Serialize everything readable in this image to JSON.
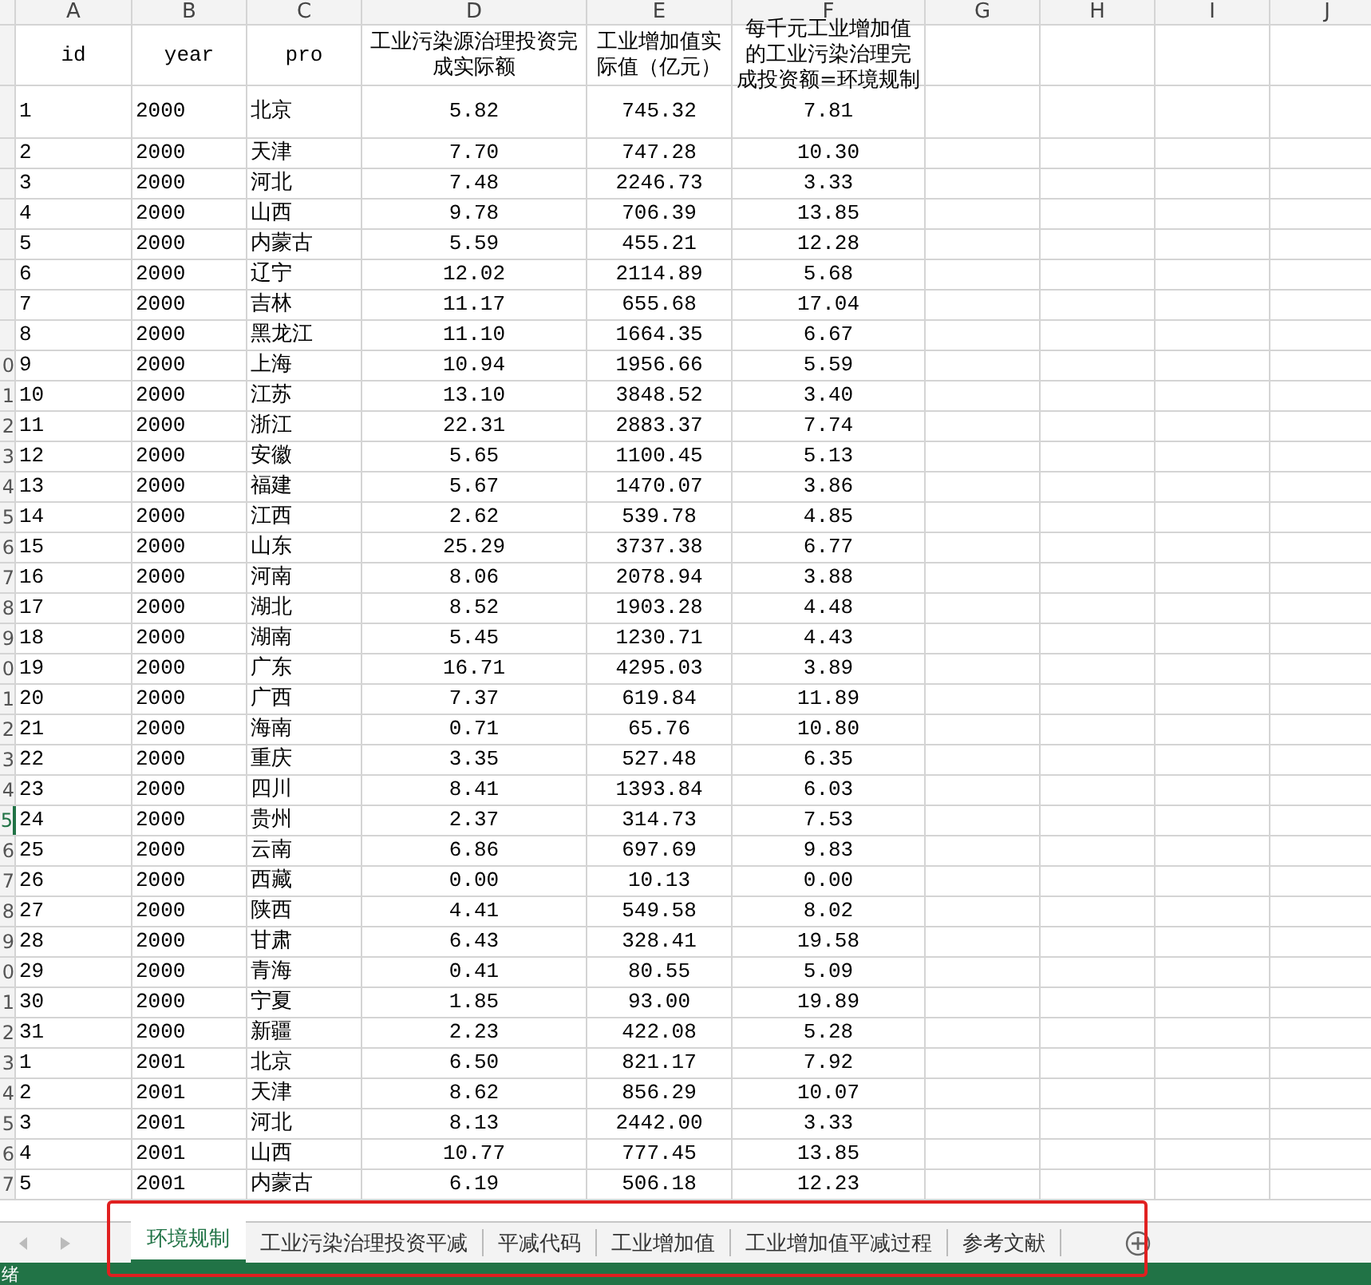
{
  "column_letters": [
    "A",
    "B",
    "C",
    "D",
    "E",
    "F",
    "G",
    "H",
    "I",
    "J"
  ],
  "header_row": [
    "id",
    "year",
    "pro",
    "工业污染源治理投资完成实际额",
    "工业增加值实际值（亿元）",
    "每千元工业增加值的工业污染治理完成投资额=环境规制"
  ],
  "rows": [
    {
      "row_number": "",
      "selected": false,
      "cells": [
        "1",
        "2000",
        "北京",
        "5.82",
        "745.32",
        "7.81"
      ]
    },
    {
      "row_number": "",
      "selected": false,
      "cells": [
        "2",
        "2000",
        "天津",
        "7.70",
        "747.28",
        "10.30"
      ]
    },
    {
      "row_number": "",
      "selected": false,
      "cells": [
        "3",
        "2000",
        "河北",
        "7.48",
        "2246.73",
        "3.33"
      ]
    },
    {
      "row_number": "",
      "selected": false,
      "cells": [
        "4",
        "2000",
        "山西",
        "9.78",
        "706.39",
        "13.85"
      ]
    },
    {
      "row_number": "",
      "selected": false,
      "cells": [
        "5",
        "2000",
        "内蒙古",
        "5.59",
        "455.21",
        "12.28"
      ]
    },
    {
      "row_number": "",
      "selected": false,
      "cells": [
        "6",
        "2000",
        "辽宁",
        "12.02",
        "2114.89",
        "5.68"
      ]
    },
    {
      "row_number": "",
      "selected": false,
      "cells": [
        "7",
        "2000",
        "吉林",
        "11.17",
        "655.68",
        "17.04"
      ]
    },
    {
      "row_number": "",
      "selected": false,
      "cells": [
        "8",
        "2000",
        "黑龙江",
        "11.10",
        "1664.35",
        "6.67"
      ]
    },
    {
      "row_number": "0",
      "selected": false,
      "cells": [
        "9",
        "2000",
        "上海",
        "10.94",
        "1956.66",
        "5.59"
      ]
    },
    {
      "row_number": "1",
      "selected": false,
      "cells": [
        "10",
        "2000",
        "江苏",
        "13.10",
        "3848.52",
        "3.40"
      ]
    },
    {
      "row_number": "2",
      "selected": false,
      "cells": [
        "11",
        "2000",
        "浙江",
        "22.31",
        "2883.37",
        "7.74"
      ]
    },
    {
      "row_number": "3",
      "selected": false,
      "cells": [
        "12",
        "2000",
        "安徽",
        "5.65",
        "1100.45",
        "5.13"
      ]
    },
    {
      "row_number": "4",
      "selected": false,
      "cells": [
        "13",
        "2000",
        "福建",
        "5.67",
        "1470.07",
        "3.86"
      ]
    },
    {
      "row_number": "5",
      "selected": false,
      "cells": [
        "14",
        "2000",
        "江西",
        "2.62",
        "539.78",
        "4.85"
      ]
    },
    {
      "row_number": "6",
      "selected": false,
      "cells": [
        "15",
        "2000",
        "山东",
        "25.29",
        "3737.38",
        "6.77"
      ]
    },
    {
      "row_number": "7",
      "selected": false,
      "cells": [
        "16",
        "2000",
        "河南",
        "8.06",
        "2078.94",
        "3.88"
      ]
    },
    {
      "row_number": "8",
      "selected": false,
      "cells": [
        "17",
        "2000",
        "湖北",
        "8.52",
        "1903.28",
        "4.48"
      ]
    },
    {
      "row_number": "9",
      "selected": false,
      "cells": [
        "18",
        "2000",
        "湖南",
        "5.45",
        "1230.71",
        "4.43"
      ]
    },
    {
      "row_number": "0",
      "selected": false,
      "cells": [
        "19",
        "2000",
        "广东",
        "16.71",
        "4295.03",
        "3.89"
      ]
    },
    {
      "row_number": "1",
      "selected": false,
      "cells": [
        "20",
        "2000",
        "广西",
        "7.37",
        "619.84",
        "11.89"
      ]
    },
    {
      "row_number": "2",
      "selected": false,
      "cells": [
        "21",
        "2000",
        "海南",
        "0.71",
        "65.76",
        "10.80"
      ]
    },
    {
      "row_number": "3",
      "selected": false,
      "cells": [
        "22",
        "2000",
        "重庆",
        "3.35",
        "527.48",
        "6.35"
      ]
    },
    {
      "row_number": "4",
      "selected": false,
      "cells": [
        "23",
        "2000",
        "四川",
        "8.41",
        "1393.84",
        "6.03"
      ]
    },
    {
      "row_number": "5",
      "selected": true,
      "cells": [
        "24",
        "2000",
        "贵州",
        "2.37",
        "314.73",
        "7.53"
      ]
    },
    {
      "row_number": "6",
      "selected": false,
      "cells": [
        "25",
        "2000",
        "云南",
        "6.86",
        "697.69",
        "9.83"
      ]
    },
    {
      "row_number": "7",
      "selected": false,
      "cells": [
        "26",
        "2000",
        "西藏",
        "0.00",
        "10.13",
        "0.00"
      ]
    },
    {
      "row_number": "8",
      "selected": false,
      "cells": [
        "27",
        "2000",
        "陕西",
        "4.41",
        "549.58",
        "8.02"
      ]
    },
    {
      "row_number": "9",
      "selected": false,
      "cells": [
        "28",
        "2000",
        "甘肃",
        "6.43",
        "328.41",
        "19.58"
      ]
    },
    {
      "row_number": "0",
      "selected": false,
      "cells": [
        "29",
        "2000",
        "青海",
        "0.41",
        "80.55",
        "5.09"
      ]
    },
    {
      "row_number": "1",
      "selected": false,
      "cells": [
        "30",
        "2000",
        "宁夏",
        "1.85",
        "93.00",
        "19.89"
      ]
    },
    {
      "row_number": "2",
      "selected": false,
      "cells": [
        "31",
        "2000",
        "新疆",
        "2.23",
        "422.08",
        "5.28"
      ]
    },
    {
      "row_number": "3",
      "selected": false,
      "cells": [
        "1",
        "2001",
        "北京",
        "6.50",
        "821.17",
        "7.92"
      ]
    },
    {
      "row_number": "4",
      "selected": false,
      "cells": [
        "2",
        "2001",
        "天津",
        "8.62",
        "856.29",
        "10.07"
      ]
    },
    {
      "row_number": "5",
      "selected": false,
      "cells": [
        "3",
        "2001",
        "河北",
        "8.13",
        "2442.00",
        "3.33"
      ]
    },
    {
      "row_number": "6",
      "selected": false,
      "cells": [
        "4",
        "2001",
        "山西",
        "10.77",
        "777.45",
        "13.85"
      ]
    },
    {
      "row_number": "7",
      "selected": false,
      "cells": [
        "5",
        "2001",
        "内蒙古",
        "6.19",
        "506.18",
        "12.23"
      ]
    }
  ],
  "sheet_tabs": [
    {
      "label": "环境规制",
      "selected": true
    },
    {
      "label": "工业污染治理投资平减",
      "selected": false
    },
    {
      "label": "平减代码",
      "selected": false
    },
    {
      "label": "工业增加值",
      "selected": false
    },
    {
      "label": "工业增加值平减过程",
      "selected": false
    },
    {
      "label": "参考文献",
      "selected": false
    }
  ],
  "status_bar": {
    "text": "绪"
  }
}
